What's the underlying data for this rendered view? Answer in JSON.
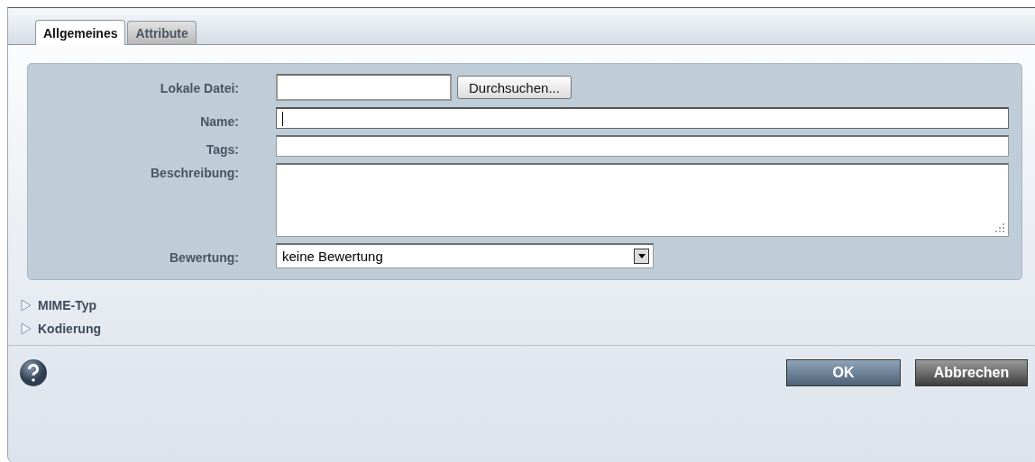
{
  "tabs": [
    {
      "label": "Allgemeines",
      "selected": true
    },
    {
      "label": "Attribute",
      "selected": false
    }
  ],
  "form": {
    "fields": [
      {
        "kind": "file",
        "label": "Lokale Datei:",
        "button": "Durchsuchen..."
      },
      {
        "kind": "text",
        "label": "Name:",
        "focused": true
      },
      {
        "kind": "text",
        "label": "Tags:",
        "focused": false
      },
      {
        "kind": "textarea",
        "label": "Beschreibung:"
      },
      {
        "kind": "select",
        "label": "Bewertung:",
        "value": "keine Bewertung"
      }
    ]
  },
  "sections": [
    {
      "label": "MIME-Typ",
      "expanded": false
    },
    {
      "label": "Kodierung",
      "expanded": false
    }
  ],
  "buttons": [
    {
      "label": "OK",
      "kind": "primary"
    },
    {
      "label": "Abbrechen",
      "kind": "secondary"
    }
  ]
}
